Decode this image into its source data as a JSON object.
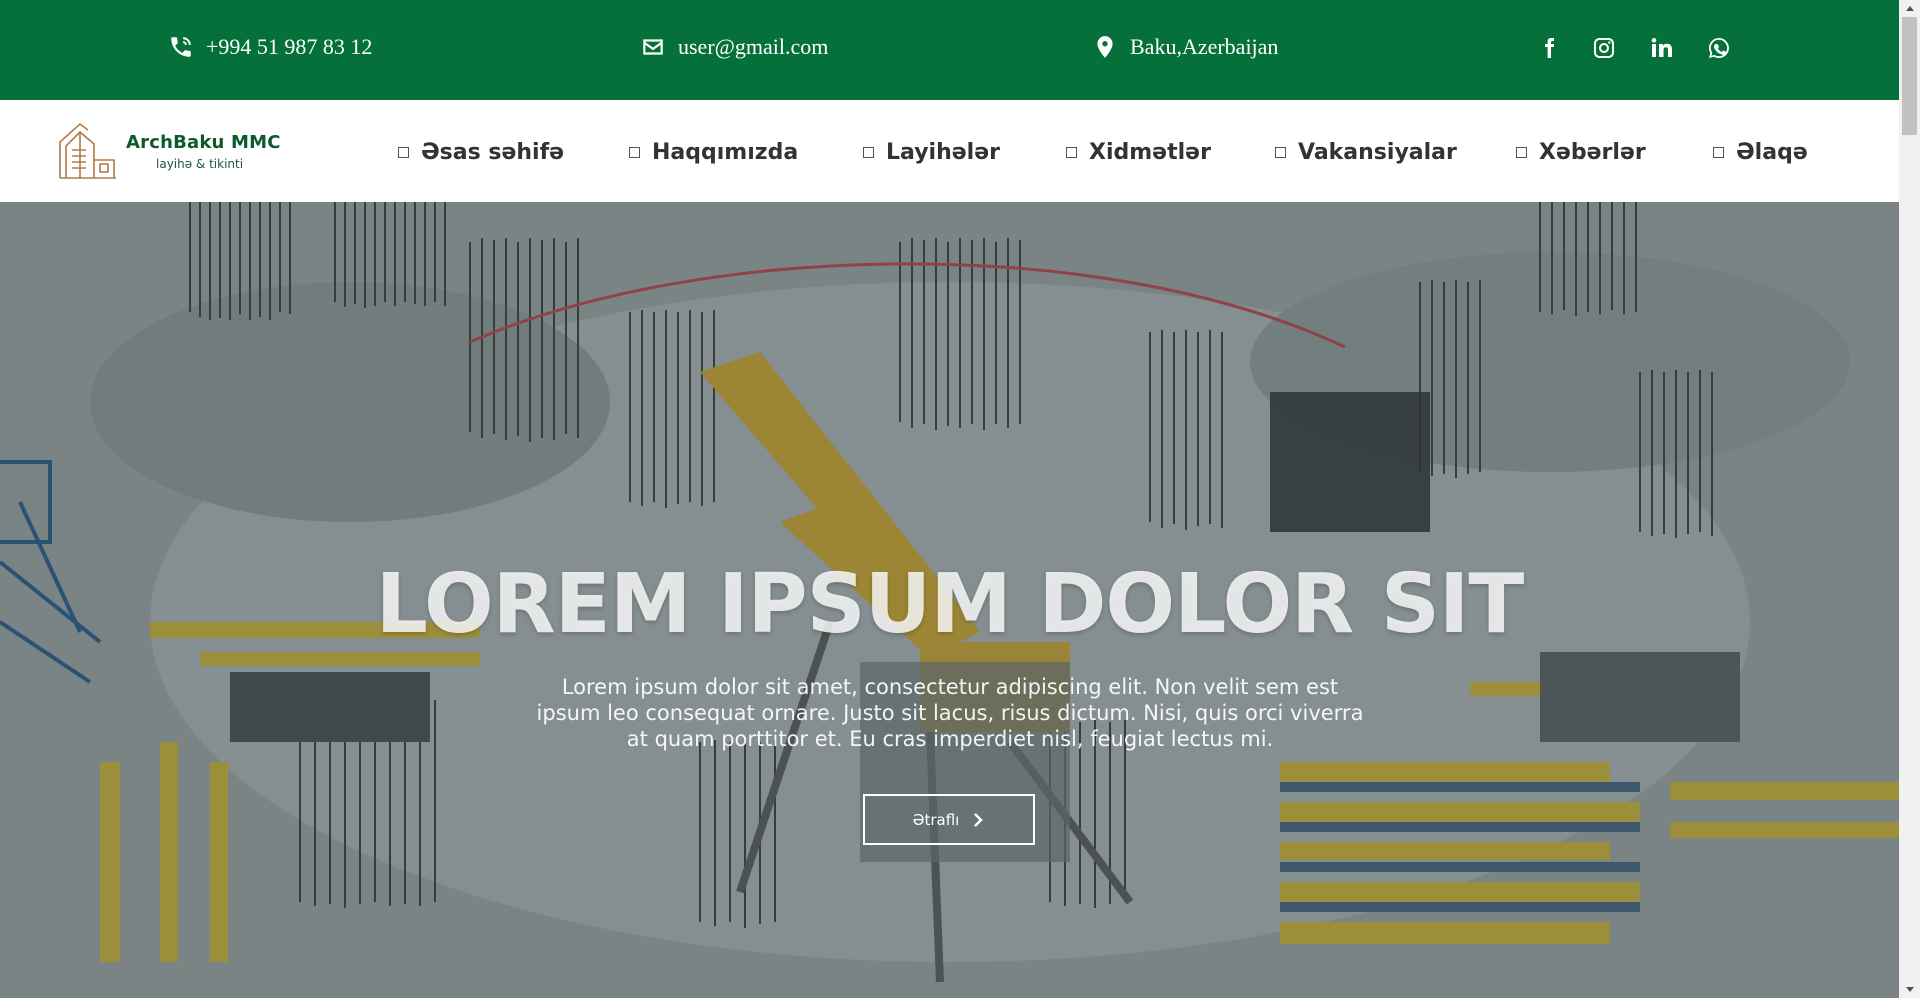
{
  "topbar": {
    "phone": "+994 51 987 83 12",
    "email": "user@gmail.com",
    "location": "Baku,Azerbaijan",
    "social": [
      "facebook-icon",
      "instagram-icon",
      "linkedin-icon",
      "whatsapp-icon"
    ],
    "bg_color": "#05703a"
  },
  "logo": {
    "brand": "ArchBaku MMC",
    "tagline": "layihə & tikinti"
  },
  "nav": {
    "items": [
      "Əsas səhifə",
      "Haqqımızda",
      "Layihələr",
      "Xidmətlər",
      "Vakansiyalar",
      "Xəbərlər",
      "Əlaqə"
    ]
  },
  "hero": {
    "title": "LOREM IPSUM DOLOR SIT",
    "text": "Lorem ipsum dolor sit amet, consectetur adipiscing elit. Non velit sem est ipsum leo consequat ornare. Justo sit lacus, risus dictum. Nisi, quis orci viverra at quam porttitor et. Eu cras imperdiet nisl, feugiat lectus mi.",
    "button_label": "Ətraflı"
  }
}
